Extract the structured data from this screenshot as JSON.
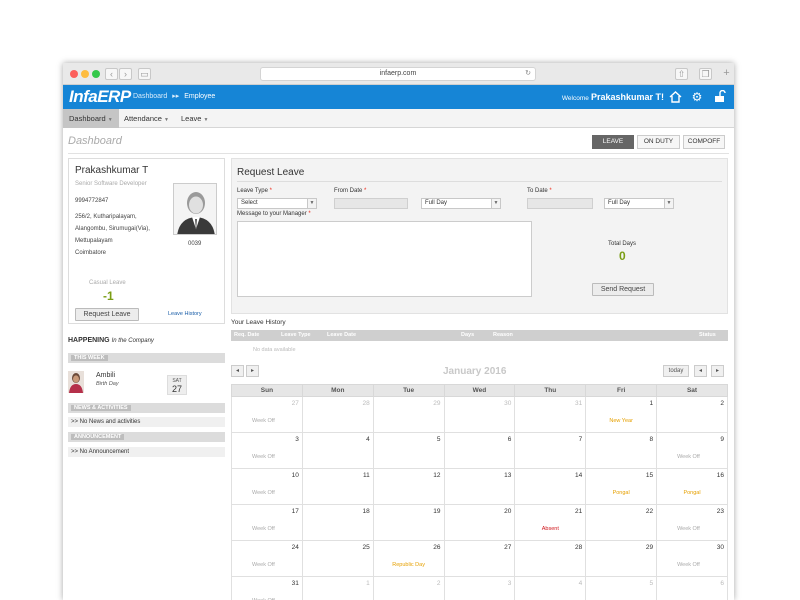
{
  "browser": {
    "url": "infaerp.com"
  },
  "app": {
    "logo": "InfaERP",
    "breadcrumb": [
      "Dashboard",
      "Employee"
    ],
    "breadcrumb_sep": "▸▸",
    "welcome_prefix": "Welcome",
    "user": "Prakashkumar T!"
  },
  "menu": [
    {
      "label": "Dashboard",
      "caret": "▼"
    },
    {
      "label": "Attendance",
      "caret": "▼"
    },
    {
      "label": "Leave",
      "caret": "▼"
    }
  ],
  "page_title": "Dashboard",
  "tabs": [
    "LEAVE",
    "ON DUTY",
    "COMPOFF"
  ],
  "profile": {
    "name": "Prakashkumar T",
    "designation": "Senior Software Developer",
    "phone": "9994772847",
    "address": [
      "256/2, Kutharipalayam,",
      "Alangombu, Sirumugai(Via),",
      "Mettupalayam",
      "Coimbatore"
    ],
    "emp_id": "0039",
    "casual_leave_label": "Casual Leave",
    "casual_leave_value": "-1",
    "request_button": "Request Leave",
    "history_link": "Leave History"
  },
  "happening": {
    "title": "HAPPENING",
    "subtitle": "In the Company",
    "this_week": "THIS WEEK",
    "birthday_name": "Ambili",
    "birthday_text": "Birth Day",
    "birthday_day": "SAT",
    "birthday_date": "27",
    "news_title": "NEWS & ACTIVITIES",
    "news_empty": ">> No News and activities",
    "announce_title": "ANNOUNCEMENT",
    "announce_empty": ">> No Announcement"
  },
  "request_leave": {
    "title": "Request Leave",
    "leave_type_label": "Leave Type",
    "from_date_label": "From Date",
    "to_date_label": "To Date",
    "required": "*",
    "leave_type_value": "Select",
    "from_day_value": "Full Day",
    "to_day_value": "Full Day",
    "message_label": "Message to your Manager",
    "total_days_label": "Total Days",
    "total_days_value": "0",
    "send_button": "Send Request"
  },
  "your_leave": {
    "title": "Your Leave History",
    "columns": [
      "Req. Date",
      "Leave Type",
      "Leave Date",
      "Days",
      "Reason",
      "Status"
    ],
    "empty": "No data available"
  },
  "calendar": {
    "title": "January 2016",
    "today_button": "today",
    "prev": "◂",
    "next": "▸",
    "days": [
      "Sun",
      "Mon",
      "Tue",
      "Wed",
      "Thu",
      "Fri",
      "Sat"
    ],
    "weeks": [
      [
        {
          "d": "27",
          "o": true,
          "e": "Week Off",
          "t": "wk"
        },
        {
          "d": "28",
          "o": true
        },
        {
          "d": "29",
          "o": true
        },
        {
          "d": "30",
          "o": true
        },
        {
          "d": "31",
          "o": true
        },
        {
          "d": "1",
          "e": "New Year",
          "t": "hol"
        },
        {
          "d": "2"
        }
      ],
      [
        {
          "d": "3",
          "e": "Week Off",
          "t": "wk"
        },
        {
          "d": "4"
        },
        {
          "d": "5"
        },
        {
          "d": "6"
        },
        {
          "d": "7"
        },
        {
          "d": "8"
        },
        {
          "d": "9",
          "e": "Week Off",
          "t": "wk"
        }
      ],
      [
        {
          "d": "10",
          "e": "Week Off",
          "t": "wk"
        },
        {
          "d": "11"
        },
        {
          "d": "12"
        },
        {
          "d": "13"
        },
        {
          "d": "14"
        },
        {
          "d": "15",
          "e": "Pongal",
          "t": "hol"
        },
        {
          "d": "16",
          "e": "Pongal",
          "t": "hol"
        }
      ],
      [
        {
          "d": "17",
          "e": "Week Off",
          "t": "wk"
        },
        {
          "d": "18"
        },
        {
          "d": "19"
        },
        {
          "d": "20"
        },
        {
          "d": "21",
          "e": "Absent",
          "t": "abs"
        },
        {
          "d": "22"
        },
        {
          "d": "23",
          "e": "Week Off",
          "t": "wk"
        }
      ],
      [
        {
          "d": "24",
          "e": "Week Off",
          "t": "wk"
        },
        {
          "d": "25"
        },
        {
          "d": "26",
          "e": "Republic Day",
          "t": "hol"
        },
        {
          "d": "27"
        },
        {
          "d": "28"
        },
        {
          "d": "29"
        },
        {
          "d": "30",
          "e": "Week Off",
          "t": "wk"
        }
      ],
      [
        {
          "d": "31",
          "e": "Week Off",
          "t": "wk"
        },
        {
          "d": "1",
          "o": true
        },
        {
          "d": "2",
          "o": true
        },
        {
          "d": "3",
          "o": true
        },
        {
          "d": "4",
          "o": true
        },
        {
          "d": "5",
          "o": true
        },
        {
          "d": "6",
          "o": true
        }
      ]
    ]
  },
  "colors": {
    "brand": "#1685d6",
    "active_tab": "#666666",
    "accent_green": "#7a9d14",
    "holiday": "#e6a000",
    "absent": "#d0151b"
  }
}
